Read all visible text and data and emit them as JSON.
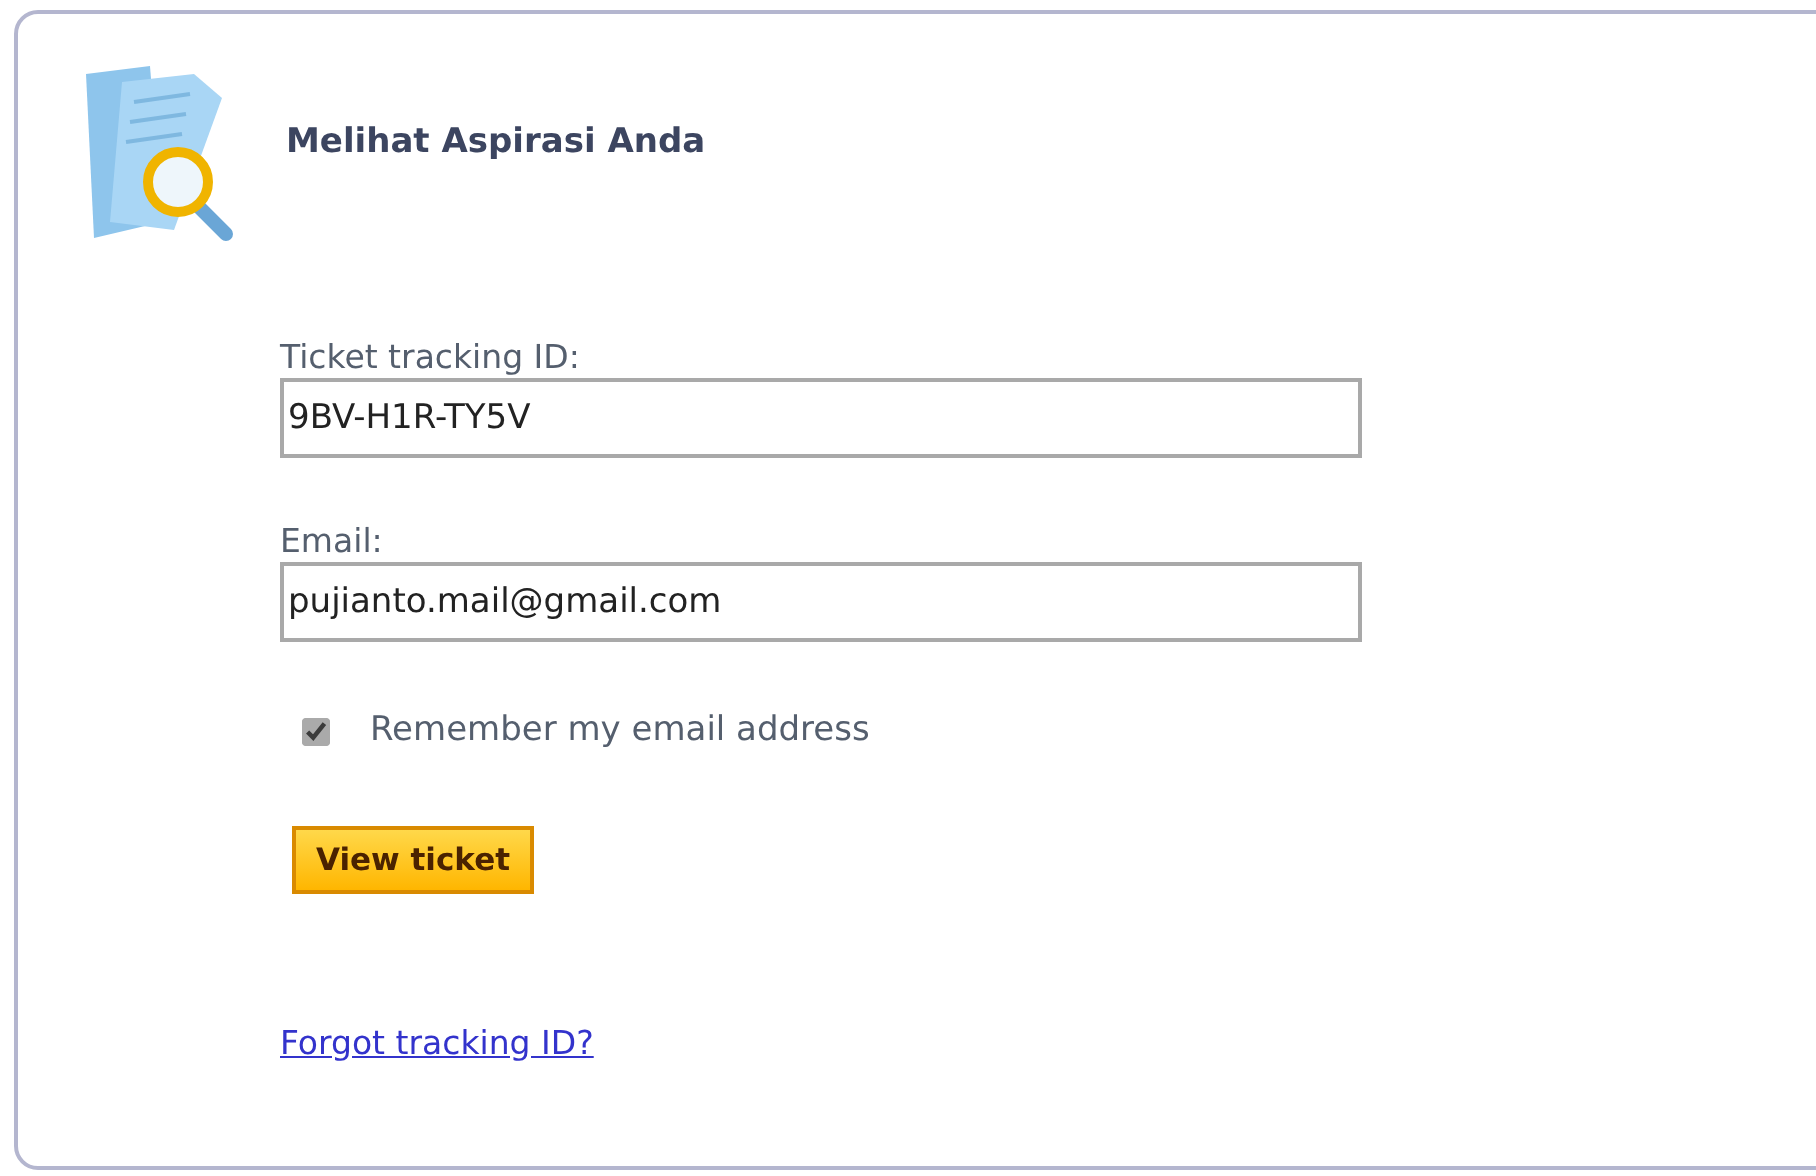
{
  "title": "Melihat Aspirasi Anda",
  "fields": [
    {
      "label": "Ticket tracking ID:",
      "value": "9BV-H1R-TY5V"
    },
    {
      "label": "Email:",
      "value": "pujianto.mail@gmail.com"
    }
  ],
  "remember": {
    "label": "Remember my email address",
    "checked": true
  },
  "button": "View ticket",
  "link": "Forgot tracking ID?"
}
